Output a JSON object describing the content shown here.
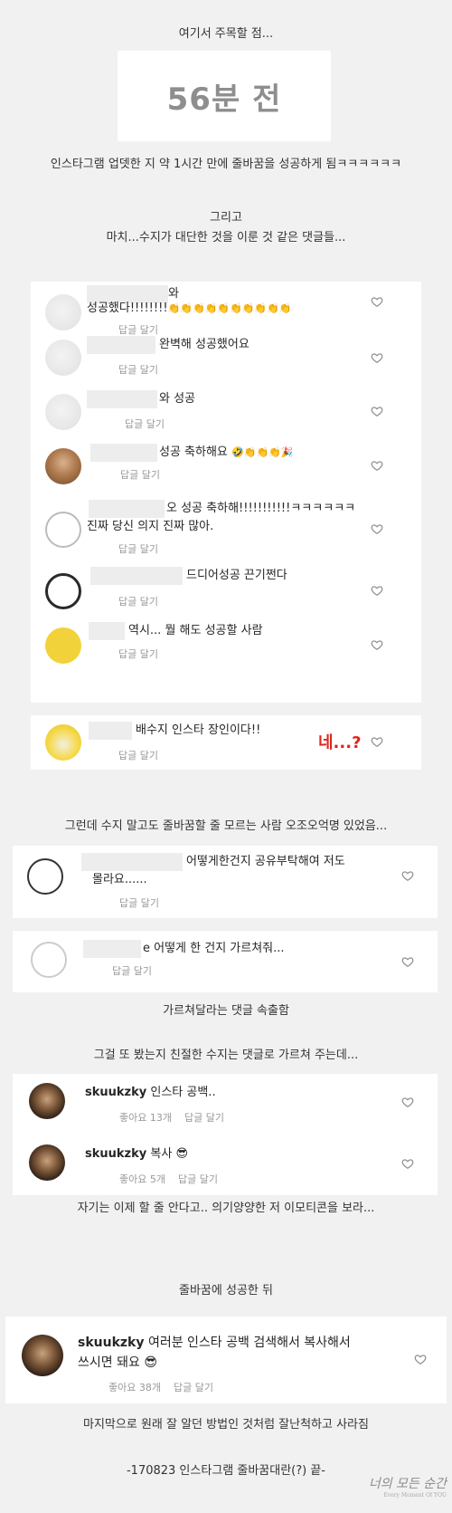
{
  "captions": {
    "c1": "여기서 주목할 점...",
    "c2": "인스타그램 업뎃한 지 약 1시간 만에 줄바꿈을 성공하게 됨ㅋㅋㅋㅋㅋㅋ",
    "c3a": "그리고",
    "c3b": "마치...수지가 대단한 것을 이룬 것 같은 댓글들...",
    "c4": "그런데 수지 말고도 줄바꿈할 줄 모르는 사람 오조오억명 있었음...",
    "c5": "가르쳐달라는 댓글 속출함",
    "c6": "그걸 또 봤는지 친절한 수지는 댓글로 가르쳐 주는데...",
    "c7": "자기는 이제 할 줄 안다고.. 의기양양한 저 이모티콘을 보라...",
    "c8": "줄바꿈에 성공한 뒤",
    "c9": "마지막으로 원래 잘 알던 방법인 것처럼 잘난척하고 사라짐",
    "c10": "-170823 인스타그램 줄바꿈대란(?) 끝-"
  },
  "time_box": "56분 전",
  "reply": "답글 달기",
  "comments_a": [
    {
      "line1": "와",
      "line2": "성공했다!!!!!!!!",
      "emoji": "👏👏👏👏👏👏👏👏👏👏"
    },
    {
      "line1": "완벽해 성공했어요"
    },
    {
      "line1": "와 성공"
    },
    {
      "line1": "성공 축하해요",
      "emoji": "🤣👏👏👏🎉"
    },
    {
      "line1": "오 성공 축하해!!!!!!!!!!!ㅋㅋㅋㅋㅋㅋ",
      "line2": "진짜 당신 의지 진짜 많아."
    },
    {
      "line1": "드디어성공 끈기쩐다"
    },
    {
      "line1": "역시... 뭘 해도 성공할 사람"
    }
  ],
  "comment_b": {
    "text": "배수지 인스타 장인이다!!",
    "reaction": "네...?"
  },
  "comments_c": [
    {
      "line1": "어떻게한건지 공유부탁해여 저도",
      "line2": "몰라요......"
    },
    {
      "line1": "e 어떻게 한 건지 가르쳐줘..."
    }
  ],
  "comments_d": [
    {
      "user": "skuukzky",
      "text": "인스타 공백..",
      "likes": "좋아요 13개"
    },
    {
      "user": "skuukzky",
      "text": "복사",
      "emoji": "😎",
      "likes": "좋아요 5개"
    }
  ],
  "comment_e": {
    "user": "skuukzky",
    "line1": "여러분 인스타 공백 검색해서 복사해서",
    "line2": "쓰시면 돼요",
    "emoji": "😎",
    "likes": "좋아요 38개"
  },
  "watermark": {
    "text": "너의 모든 순간",
    "sub": "Every Moment Of YOU"
  },
  "icons": {
    "heart": "heart-outline-icon"
  },
  "colors": {
    "background": "#f1f1f1",
    "panel": "#ffffff",
    "accent_red": "#e0261b"
  }
}
